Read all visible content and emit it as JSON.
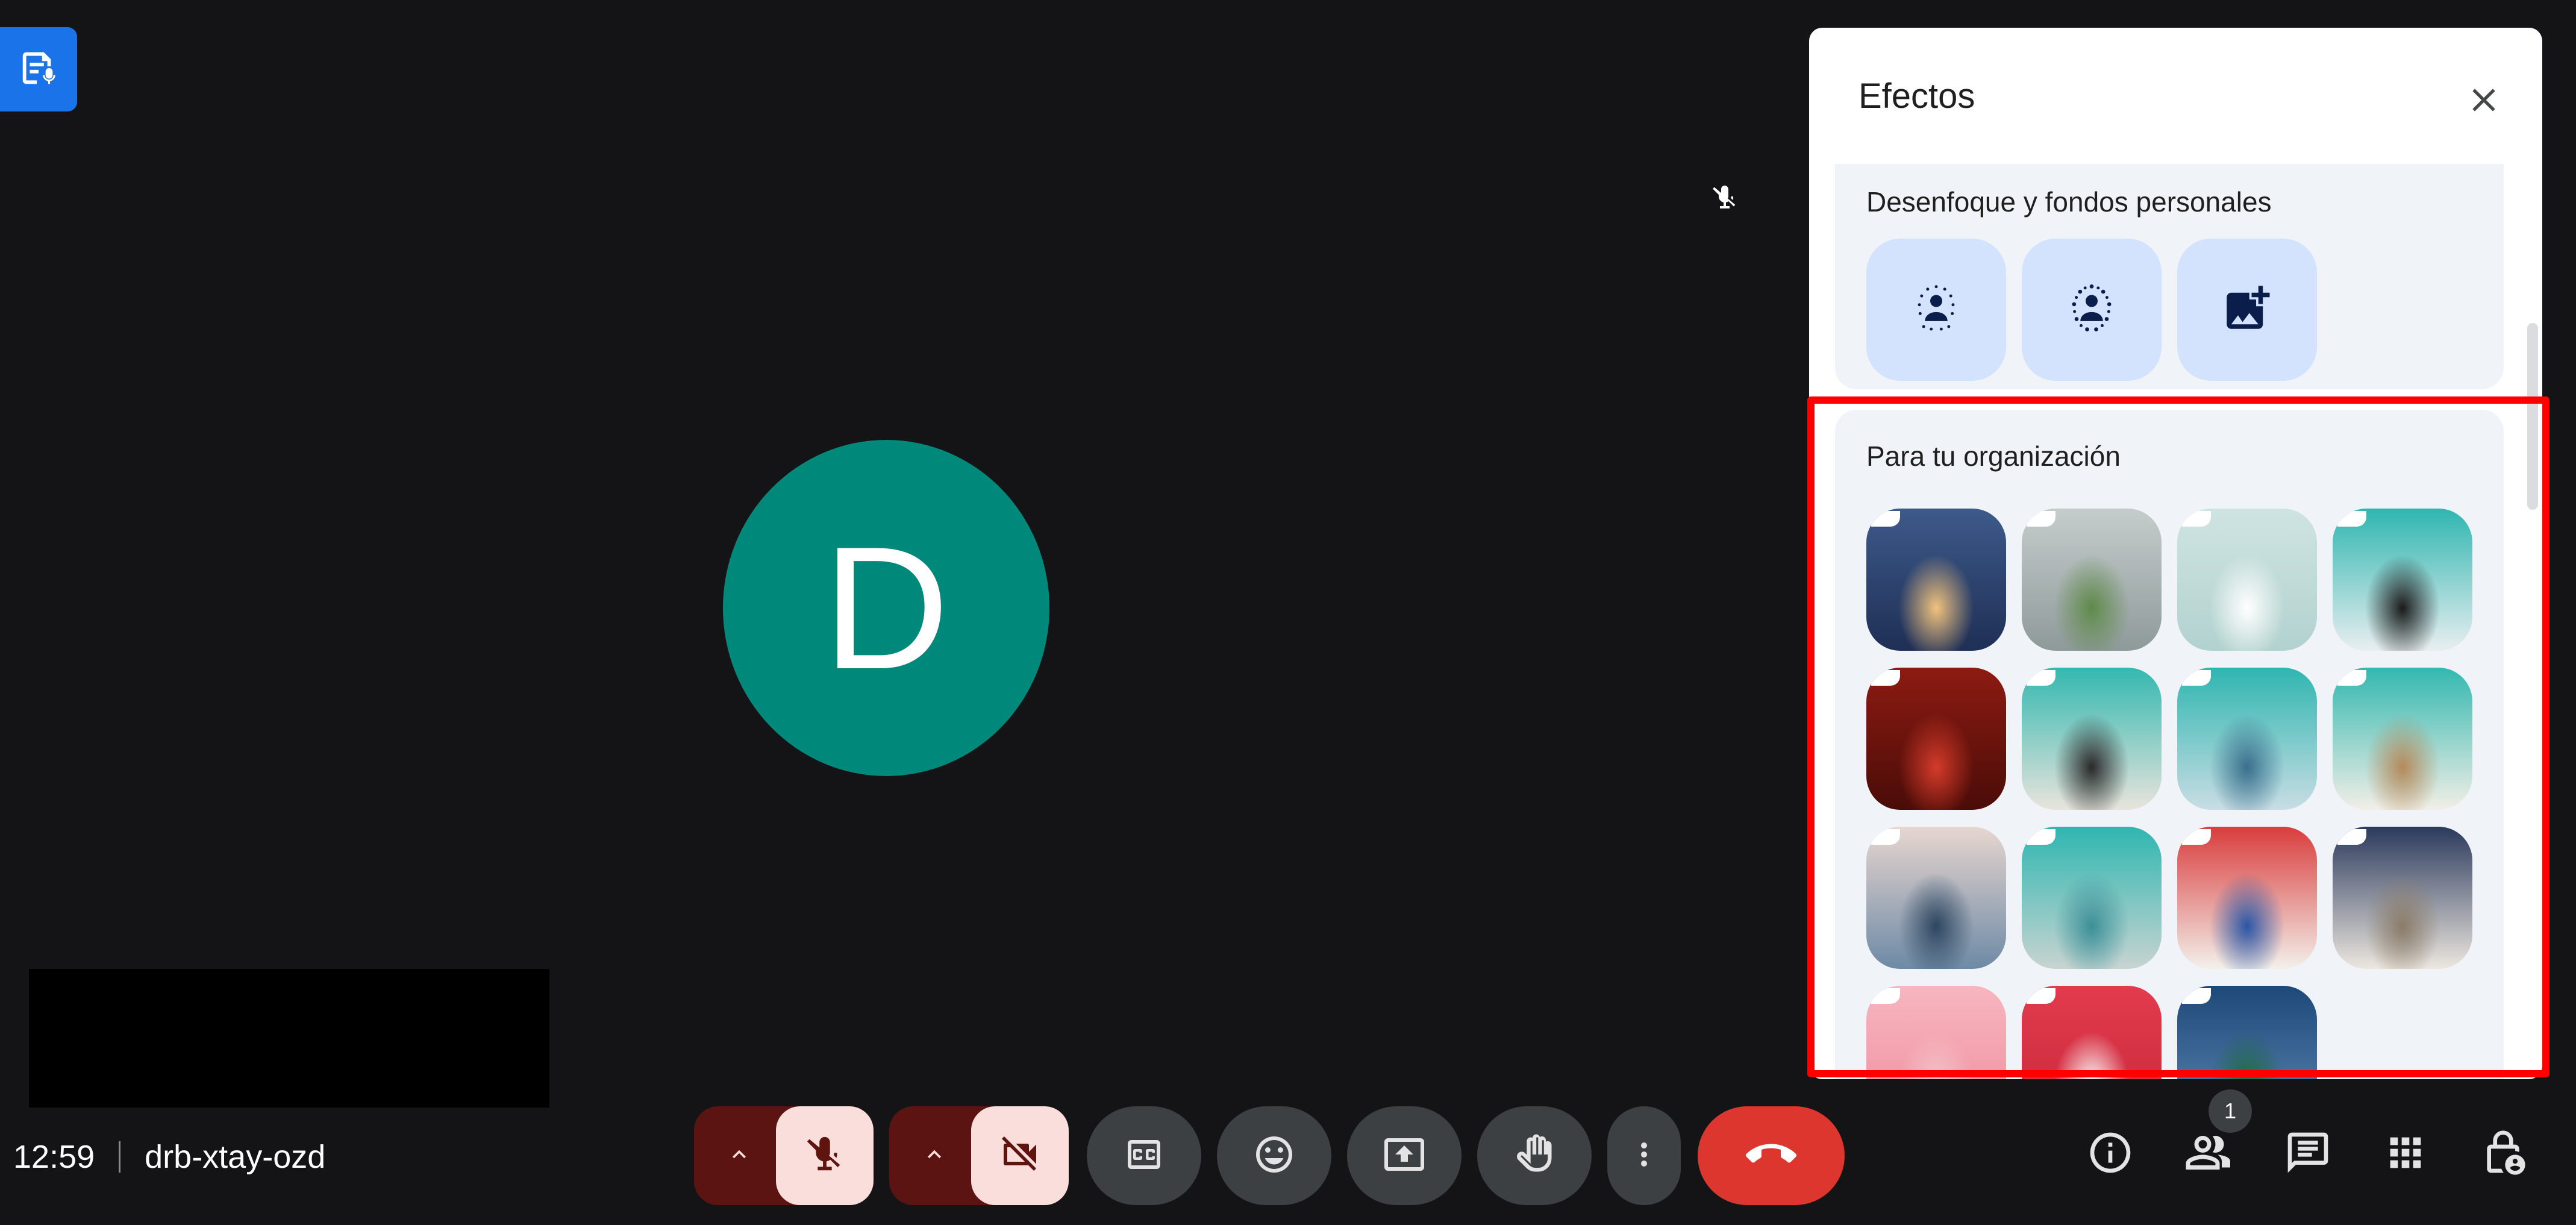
{
  "meeting": {
    "time": "12:59",
    "code": "drb-xtay-ozd"
  },
  "participant": {
    "initial": "D",
    "avatar_color": "#00897b"
  },
  "effects_panel": {
    "title": "Efectos",
    "section_blur": {
      "title": "Desenfoque y fondos personales",
      "items": [
        {
          "name": "slight-blur",
          "icon": "person-blur-light-icon"
        },
        {
          "name": "blur",
          "icon": "person-blur-icon"
        },
        {
          "name": "upload-background",
          "icon": "add-image-icon"
        }
      ]
    },
    "section_org": {
      "title": "Para tu organización",
      "backgrounds": [
        {
          "desc": "animated office lounge",
          "c1": "#3d5a8a",
          "c2": "#1f2f55",
          "c3": "#f1c27d"
        },
        {
          "desc": "gray wall with plant",
          "c1": "#c5cdcc",
          "c2": "#8e9a99",
          "c3": "#5f8a4a"
        },
        {
          "desc": "white bunny minimal",
          "c1": "#cfe4e2",
          "c2": "#b2d2cf",
          "c3": "#ffffff"
        },
        {
          "desc": "white brick newri",
          "c1": "#2fb6b0",
          "c2": "#e9eef0",
          "c3": "#1b1b1b"
        },
        {
          "desc": "red restaurant",
          "c1": "#8d1b12",
          "c2": "#4a0c08",
          "c3": "#d43b2a"
        },
        {
          "desc": "living room tv",
          "c1": "#33b8b0",
          "c2": "#e8e4dc",
          "c3": "#2a2a2a"
        },
        {
          "desc": "ocean curtains",
          "c1": "#2fb6b0",
          "c2": "#c9dde4",
          "c3": "#3a6f8d"
        },
        {
          "desc": "bright interior",
          "c1": "#33b8b0",
          "c2": "#f2efe7",
          "c3": "#b48a5c"
        },
        {
          "desc": "snowy mountains",
          "c1": "#e7d6d0",
          "c2": "#6d8aa5",
          "c3": "#2d4660"
        },
        {
          "desc": "teal abstract",
          "c1": "#2fb6b0",
          "c2": "#c8d4d1",
          "c3": "#3d8f98"
        },
        {
          "desc": "kids bedroom",
          "c1": "#d93d3d",
          "c2": "#f3f0ea",
          "c3": "#2b56a5"
        },
        {
          "desc": "modern living room",
          "c1": "#2b3a5c",
          "c2": "#ece7df",
          "c3": "#8b7c69"
        },
        {
          "desc": "pink gradient",
          "c1": "#f7b6c0",
          "c2": "#ef8d9c",
          "c3": "#f3c4cc"
        },
        {
          "desc": "red cloud",
          "c1": "#e23b4d",
          "c2": "#c8283c",
          "c3": "#ffffff"
        },
        {
          "desc": "winter forest",
          "c1": "#1e4878",
          "c2": "#5d86b3",
          "c3": "#1b6b3a"
        }
      ]
    }
  },
  "participants_count": "1",
  "colors": {
    "end_call": "#dc362e",
    "muted_bg": "#f9dedc",
    "muted_group": "#5b1411",
    "highlight": "#ff0000",
    "accent_blue": "#1a73e8"
  }
}
